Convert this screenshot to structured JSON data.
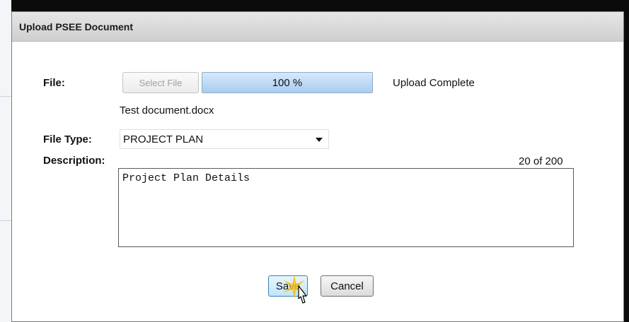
{
  "dialog": {
    "title": "Upload PSEE Document"
  },
  "form": {
    "file_label": "File:",
    "select_file_label": "Select File",
    "progress_text": "100 %",
    "progress_fraction": 1.0,
    "upload_status": "Upload Complete",
    "file_name": "Test document.docx",
    "file_type_label": "File Type:",
    "file_type_value": "PROJECT PLAN",
    "description_label": "Description:",
    "char_counter": "20 of 200",
    "description_value": "Project Plan Details"
  },
  "buttons": {
    "save_label": "Save",
    "cancel_label": "Cancel"
  },
  "colors": {
    "progress_fill": "#a9cdf0",
    "click_burst": "#f7c11c"
  },
  "icons": {
    "dropdown": "chevron-down-icon",
    "cursor": "mouse-pointer-icon"
  }
}
